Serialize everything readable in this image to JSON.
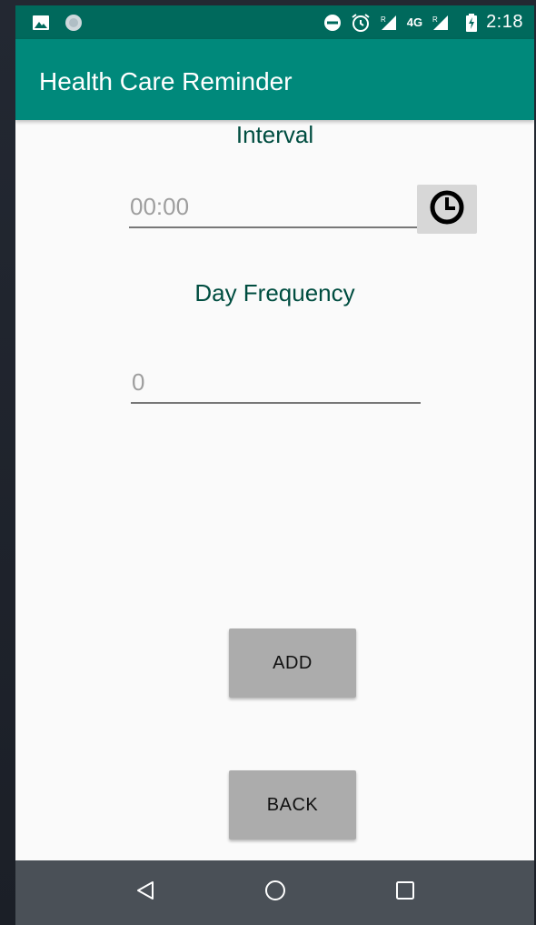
{
  "status_bar": {
    "time": "2:18",
    "network": "4G",
    "roaming_indicator": "R",
    "icons": [
      "image-icon",
      "sync-icon",
      "do-not-disturb-icon",
      "alarm-icon",
      "signal-icon",
      "battery-charging-icon"
    ]
  },
  "app_bar": {
    "title": "Health Care Reminder"
  },
  "form": {
    "interval_label": "Interval",
    "interval_placeholder": "00:00",
    "interval_value": "",
    "day_frequency_label": "Day Frequency",
    "day_frequency_placeholder": "0",
    "day_frequency_value": ""
  },
  "buttons": {
    "add_label": "ADD",
    "back_label": "BACK"
  },
  "nav_bar": {
    "icons": [
      "back-triangle-icon",
      "home-circle-icon",
      "recents-square-icon"
    ]
  },
  "colors": {
    "status_bar": "#00695c",
    "app_bar": "#00897b",
    "label_text": "#004d40",
    "button_bg": "#acacac",
    "nav_bar": "#4a5057"
  }
}
